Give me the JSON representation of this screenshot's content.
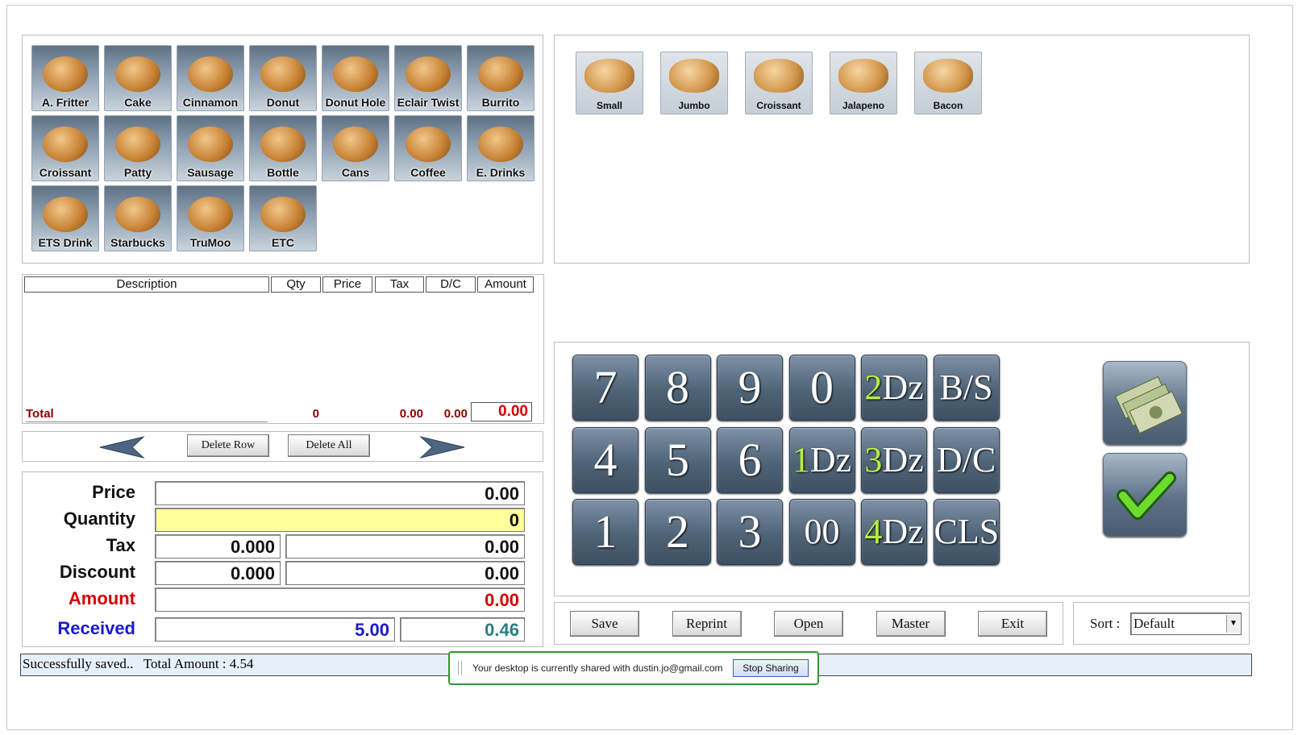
{
  "products": [
    "A. Fritter",
    "Cake",
    "Cinnamon",
    "Donut",
    "Donut Hole",
    "Eclair Twist",
    "Burrito",
    "Croissant",
    "Patty",
    "Sausage",
    "Bottle",
    "Cans",
    "Coffee",
    "E. Drinks",
    "ETS Drink",
    "Starbucks",
    "TruMoo",
    "ETC"
  ],
  "subproducts": [
    "Small",
    "Jumbo",
    "Croissant",
    "Jalapeno",
    "Bacon"
  ],
  "order": {
    "headers": [
      "Description",
      "Qty",
      "Price",
      "Tax",
      "D/C",
      "Amount"
    ],
    "total_label": "Total",
    "total_qty": "0",
    "total_tax": "0.00",
    "total_dc": "0.00",
    "total_amount": "0.00"
  },
  "row_buttons": {
    "delete_row": "Delete Row",
    "delete_all": "Delete All"
  },
  "fields": {
    "price_label": "Price",
    "price": "0.00",
    "quantity_label": "Quantity",
    "quantity": "0",
    "tax_label": "Tax",
    "tax_rate": "0.000",
    "tax_amount": "0.00",
    "discount_label": "Discount",
    "discount_rate": "0.000",
    "discount_amount": "0.00",
    "amount_label": "Amount",
    "amount": "0.00",
    "received_label": "Received",
    "received": "5.00",
    "change": "0.46"
  },
  "keypad": {
    "keys": [
      "7",
      "8",
      "9",
      "0",
      "2Dz",
      "B/S",
      "4",
      "5",
      "6",
      "1Dz",
      "3Dz",
      "D/C",
      "1",
      "2",
      "3",
      "00",
      "4Dz",
      "CLS"
    ]
  },
  "actions": [
    "Save",
    "Reprint",
    "Open",
    "Master",
    "Exit"
  ],
  "sort": {
    "label": "Sort :",
    "value": "Default"
  },
  "status": "Successfully saved..   Total Amount : 4.54",
  "share": {
    "text": "Your desktop is currently shared with dustin.jo@gmail.com",
    "button": "Stop Sharing"
  },
  "colors": {
    "received": "#1a1acc",
    "change": "#2a7f7f",
    "amount": "#d40000",
    "quantity_bg": "#ffff99",
    "share_border": "#2e9a2e"
  }
}
